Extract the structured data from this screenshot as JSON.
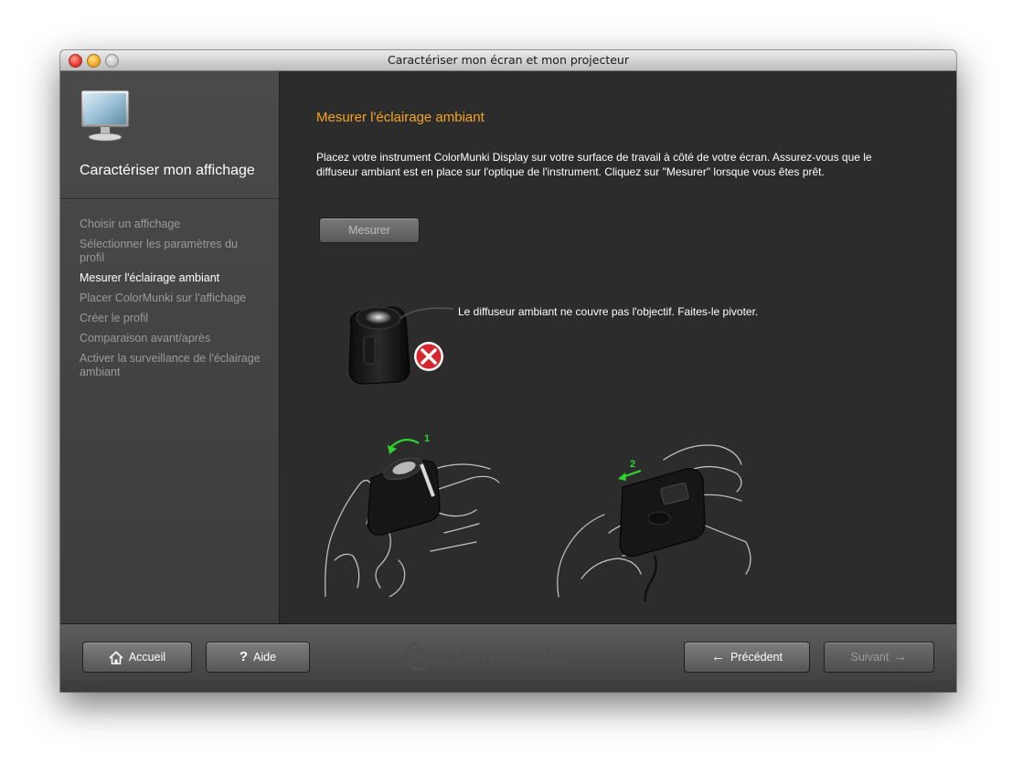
{
  "window": {
    "title": "Caractériser mon écran et mon projecteur"
  },
  "sidebar": {
    "title": "Caractériser mon affichage",
    "steps": [
      {
        "label": "Choisir un affichage",
        "active": false
      },
      {
        "label": "Sélectionner les paramètres du profil",
        "active": false
      },
      {
        "label": "Mesurer l'éclairage ambiant",
        "active": true
      },
      {
        "label": "Placer ColorMunki sur l'affichage",
        "active": false
      },
      {
        "label": "Créer le profil",
        "active": false
      },
      {
        "label": "Comparaison avant/après",
        "active": false
      },
      {
        "label": "Activer la surveillance de l'éclairage ambiant",
        "active": false
      }
    ]
  },
  "main": {
    "title": "Mesurer l'éclairage ambiant",
    "instructions": "Placez votre instrument ColorMunki Display sur votre surface de travail à côté de votre écran. Assurez-vous que le diffuseur ambiant est en place sur l'optique de l'instrument. Cliquez sur \"Mesurer\" lorsque vous êtes prêt.",
    "measure_button": "Mesurer",
    "error_message": "Le diffuseur ambiant ne couvre pas l'objectif. Faites-le pivoter.",
    "step_labels": {
      "rotate": "1",
      "slide": "2"
    }
  },
  "footer": {
    "home_label": "Accueil",
    "help_glyph": "?",
    "help_label": "Aide",
    "back_label": "Précédent",
    "next_label": "Suivant",
    "logo_light": "color",
    "logo_bold": "munki"
  },
  "colors": {
    "accent": "#f4a51c",
    "error": "#d6252c",
    "arrow": "#2ed42e"
  }
}
